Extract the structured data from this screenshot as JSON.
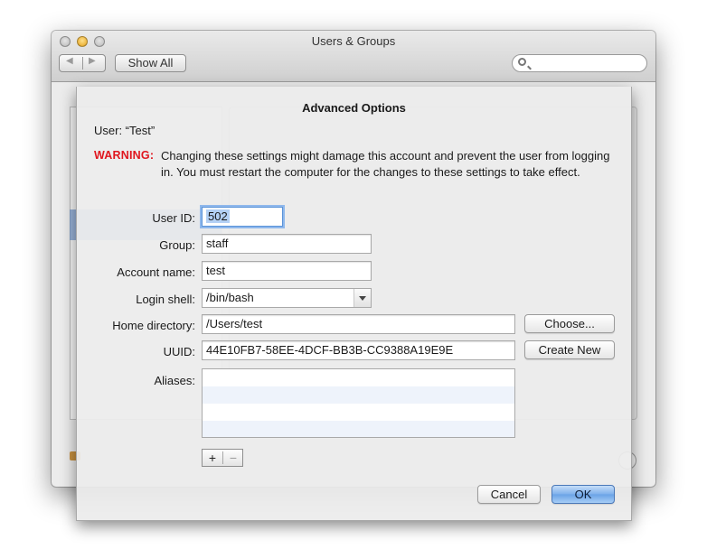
{
  "window": {
    "title": "Users & Groups",
    "show_all_label": "Show All",
    "back_glyph": "◀",
    "forward_glyph": "▶",
    "search_placeholder": ""
  },
  "dialog": {
    "title": "Advanced Options",
    "user_line": "User: “Test”",
    "warning_label": "WARNING:",
    "warning_text": "Changing these settings might damage this account and prevent the user from logging in. You must restart the computer for the changes to these settings to take effect.",
    "fields": {
      "user_id": {
        "label": "User ID:",
        "value": "502"
      },
      "group": {
        "label": "Group:",
        "value": "staff"
      },
      "account_name": {
        "label": "Account name:",
        "value": "test"
      },
      "login_shell": {
        "label": "Login shell:",
        "value": "/bin/bash"
      },
      "home_directory": {
        "label": "Home directory:",
        "value": "/Users/test"
      },
      "uuid": {
        "label": "UUID:",
        "value": "44E10FB7-58EE-4DCF-BB3B-CC9388A19E9E"
      },
      "aliases": {
        "label": "Aliases:",
        "rows": [
          "",
          "",
          "",
          ""
        ]
      }
    },
    "buttons": {
      "choose": "Choose...",
      "create_new": "Create New",
      "add": "+",
      "remove": "−",
      "cancel": "Cancel",
      "ok": "OK"
    }
  },
  "colors": {
    "warning": "#e0161e",
    "focus_ring": "#8fb8ec",
    "primary_button": "#6aa2e6"
  }
}
